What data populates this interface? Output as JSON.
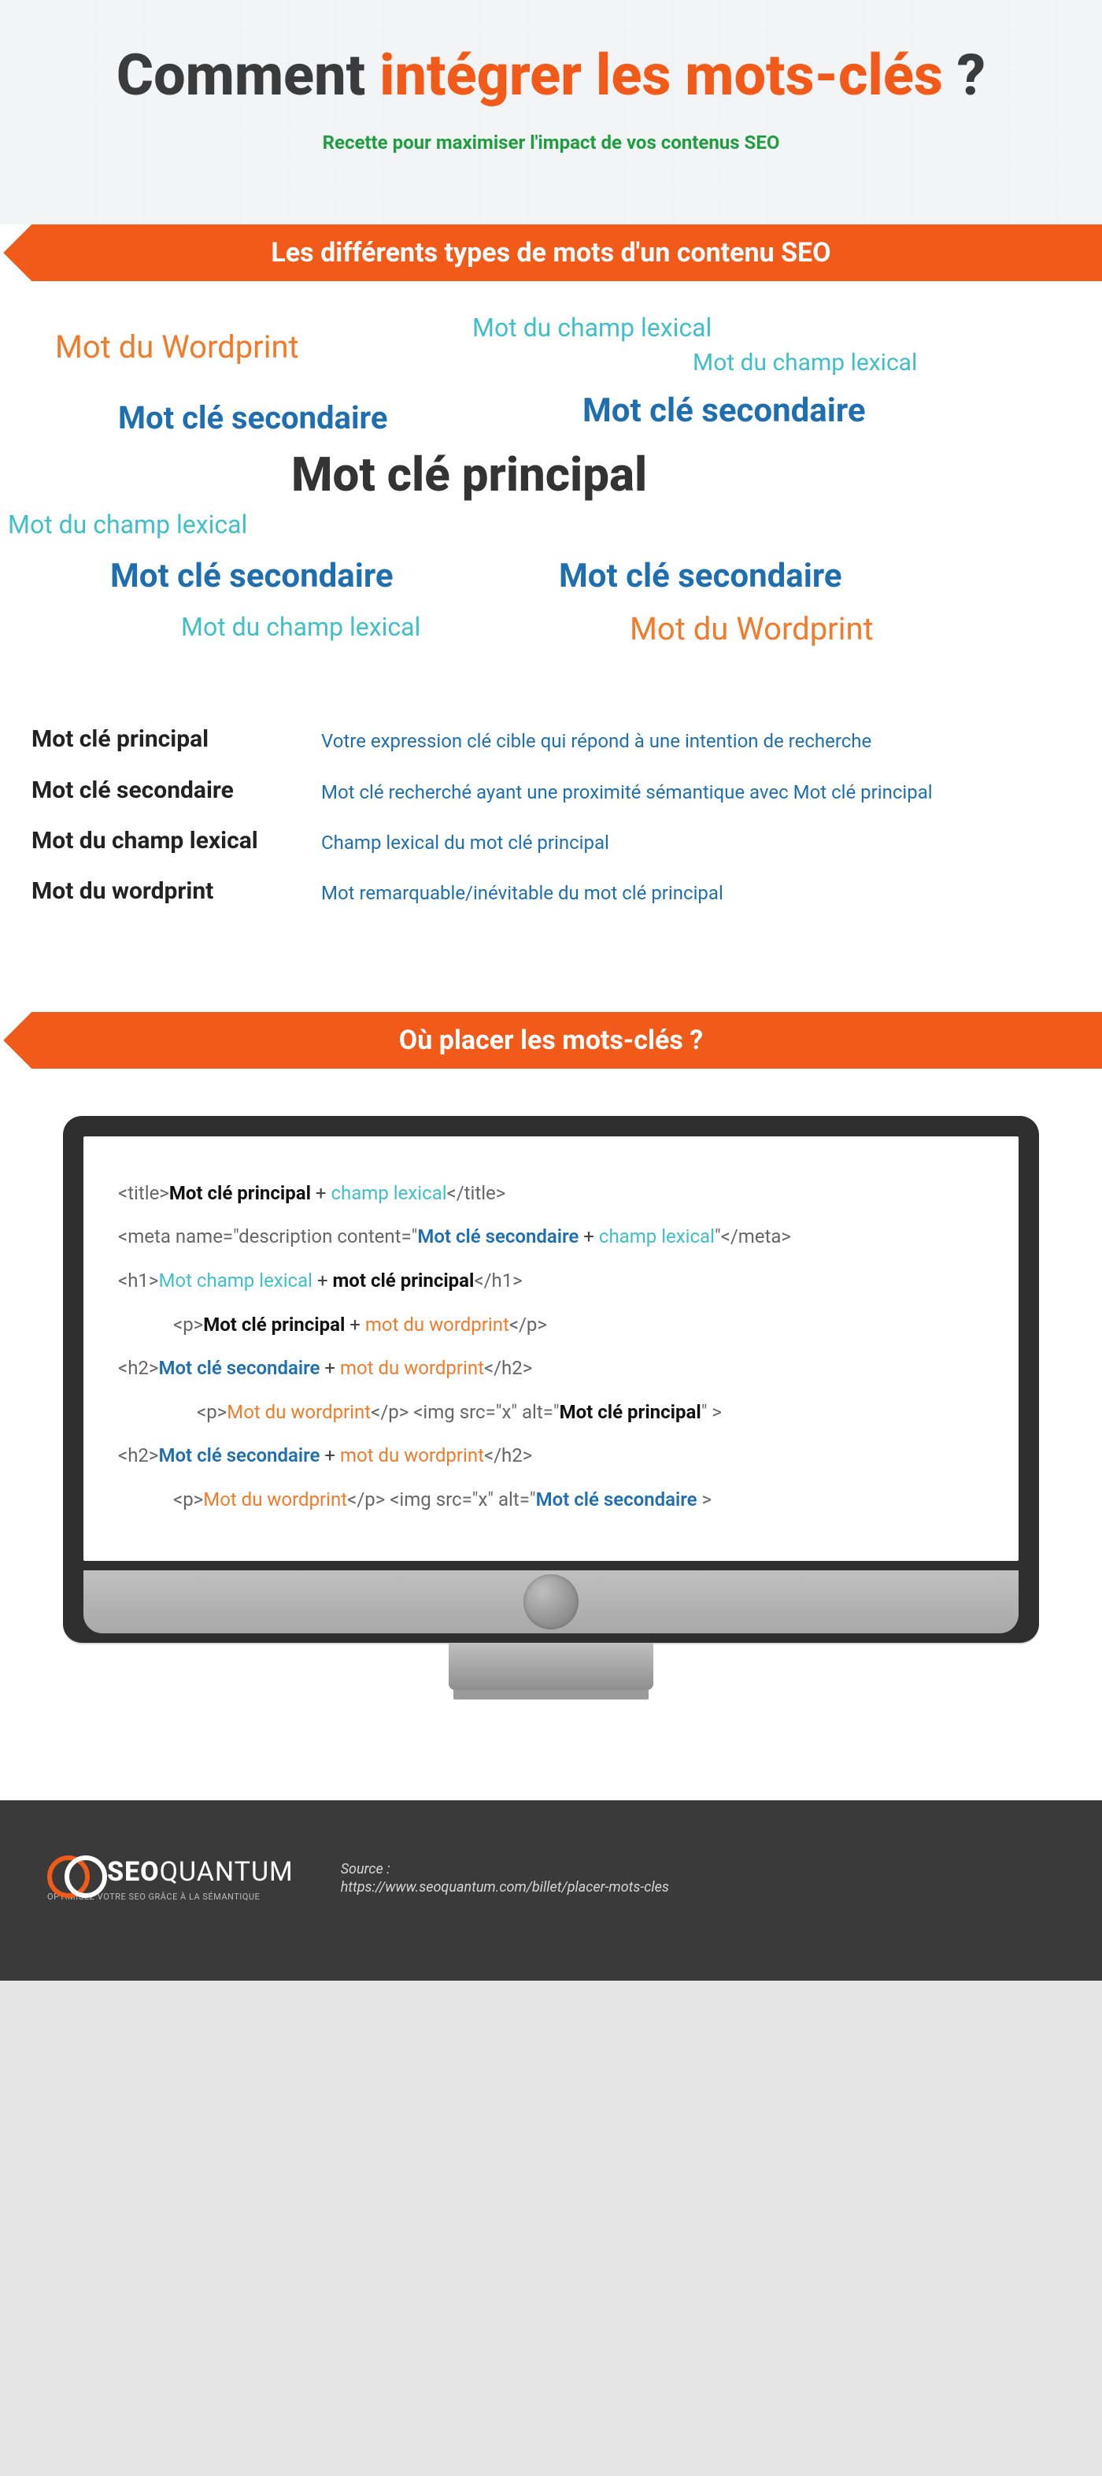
{
  "hero": {
    "title_a": "Comment ",
    "title_b": "intégrer les mots-clés",
    "title_c": " ?",
    "subtitle": "Recette pour maximiser l'impact de vos contenus SEO"
  },
  "section1_title": "Les différents types de mots d'un contenu SEO",
  "cloud": {
    "wordprint": "Mot du Wordprint",
    "lexical": "Mot du champ lexical",
    "secondary": "Mot clé secondaire",
    "principal": "Mot clé principal"
  },
  "definitions": [
    {
      "term": "Mot clé principal",
      "desc": "Votre expression clé cible qui répond à une intention de recherche"
    },
    {
      "term": "Mot clé secondaire",
      "desc": "Mot clé recherché ayant une proximité sémantique avec Mot clé principal"
    },
    {
      "term": "Mot du champ lexical",
      "desc": "Champ lexical du mot clé principal"
    },
    {
      "term": "Mot du wordprint",
      "desc": "Mot remarquable/inévitable du mot clé principal"
    }
  ],
  "section2_title": "Où placer les mots-clés ?",
  "code": {
    "title_open": "<title>",
    "title_close": "</title>",
    "meta_open": "<meta name=\"description content=\"",
    "meta_close": "\"</meta>",
    "h1_open": "<h1>",
    "h1_close": "</h1>",
    "h2_open": "<h2>",
    "h2_close": "</h2>",
    "p_open": "<p>",
    "p_close": "</p>",
    "img_a": " <img src=\"x\" alt=\"",
    "img_a_close": "\" >",
    "img_b": "  <img src=\"x\" alt=\"",
    "img_b_close": " >",
    "plus": " + ",
    "kw_principal_b": "Mot clé principal",
    "kw_principal_l": "mot clé principal",
    "kw_secondaire": "Mot clé secondaire",
    "kw_champ": "champ lexical",
    "kw_motchamp": "Mot champ lexical",
    "kw_wordprint": "mot du wordprint",
    "kw_wordprint_cap": "Mot du wordprint"
  },
  "footer": {
    "brand_a": "SEO",
    "brand_b": "QUANTUM",
    "tagline": "OPTIMISEZ VOTRE SEO GRÂCE À LA SÉMANTIQUE",
    "source_label": "Source :",
    "source_url": "https://www.seoquantum.com/billet/placer-mots-cles"
  }
}
